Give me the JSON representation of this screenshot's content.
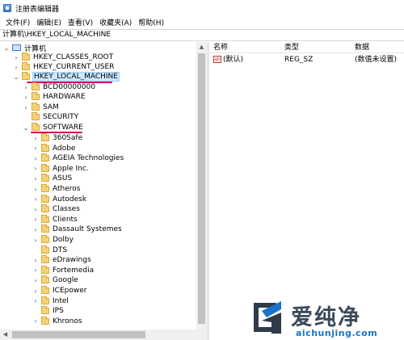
{
  "window": {
    "title": "注册表编辑器"
  },
  "menu": [
    "文件(F)",
    "编辑(E)",
    "查看(V)",
    "收藏夹(A)",
    "帮助(H)"
  ],
  "address": "计算机\\HKEY_LOCAL_MACHINE",
  "tree": {
    "root": "计算机",
    "hives": [
      "HKEY_CLASSES_ROOT",
      "HKEY_CURRENT_USER",
      "HKEY_LOCAL_MACHINE"
    ],
    "hklm_children": [
      "BCD00000000",
      "HARDWARE",
      "SAM",
      "SECURITY",
      "SOFTWARE"
    ],
    "software_children": [
      "360Safe",
      "Adobe",
      "AGEIA Technologies",
      "Apple Inc.",
      "ASUS",
      "Atheros",
      "Autodesk",
      "Classes",
      "Clients",
      "Dassault Systemes",
      "Dolby",
      "DTS",
      "eDrawings",
      "Fortemedia",
      "Google",
      "ICEpower",
      "Intel",
      "IPS",
      "Khronos"
    ],
    "selected": "HKEY_LOCAL_MACHINE"
  },
  "list": {
    "columns": [
      "名称",
      "类型",
      "数据"
    ],
    "rows": [
      {
        "name": "(默认)",
        "type": "REG_SZ",
        "data": "(数值未设置)",
        "icon": "ab"
      }
    ]
  },
  "watermark": {
    "brand": "爱纯净",
    "url": "aichunjing.com"
  },
  "colors": {
    "selection": "#cce8ff",
    "annotation": "#c2185b",
    "folder": "#f5d27a",
    "watermark_blue": "#1a73c8"
  }
}
